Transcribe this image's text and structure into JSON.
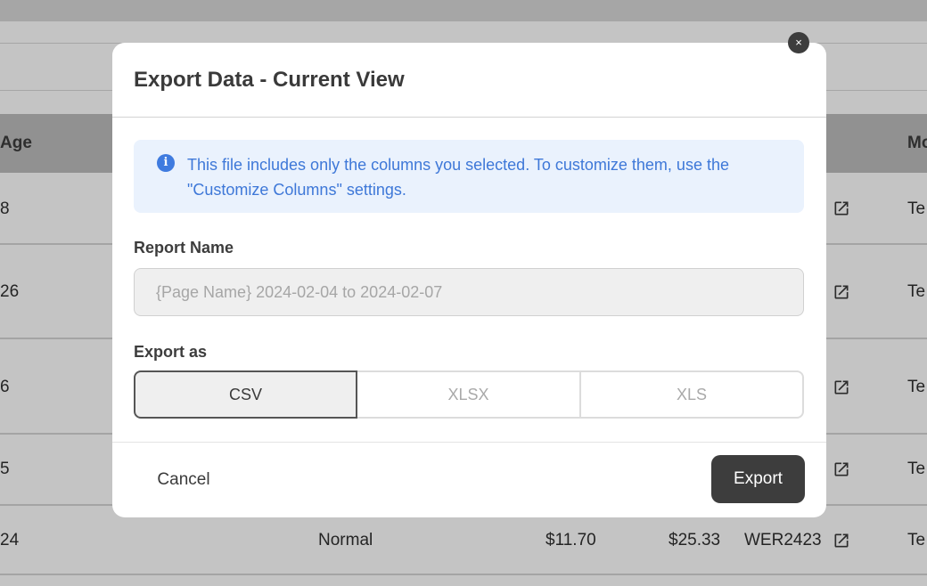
{
  "background_table": {
    "headers": {
      "age": "Age",
      "model": "Mo"
    },
    "rows": [
      {
        "age": "8",
        "model": "Te"
      },
      {
        "age": "26",
        "model": "Te"
      },
      {
        "age": "6",
        "model": "Te"
      },
      {
        "age": "5",
        "model": "Te"
      },
      {
        "age": "24",
        "type": "Normal",
        "price": "$11.70",
        "total": "$25.33",
        "code": "WER2423",
        "model": "Te"
      }
    ],
    "row_icon": "external-link-icon"
  },
  "modal": {
    "title": "Export Data - Current View",
    "close_icon": "×",
    "info": {
      "icon": "i",
      "text": "This file includes only the columns you selected. To customize them, use the \"Customize Columns\" settings."
    },
    "report_name": {
      "label": "Report Name",
      "value": "",
      "placeholder": "{Page Name} 2024-02-04 to 2024-02-07"
    },
    "export_as": {
      "label": "Export as",
      "options": [
        "CSV",
        "XLSX",
        "XLS"
      ],
      "selected": "CSV"
    },
    "cancel_label": "Cancel",
    "export_label": "Export"
  },
  "colors": {
    "info_bg": "#eaf2fd",
    "info_text": "#3e78d8",
    "primary_button": "#3d3d3d"
  }
}
